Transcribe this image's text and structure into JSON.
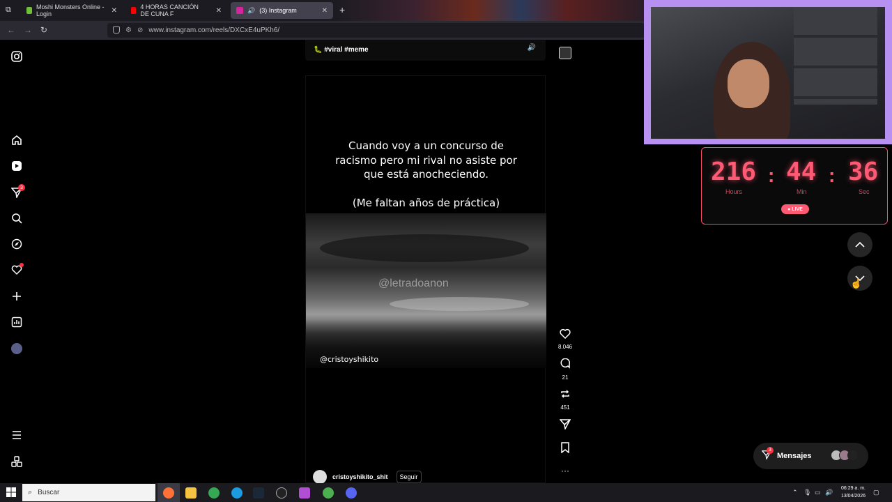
{
  "browser": {
    "tabs": [
      {
        "title": "Moshi Monsters Online - Login",
        "favicon_color": "#6fbf3b"
      },
      {
        "title": "4 HORAS CANCIÓN DE CUNA F",
        "favicon_color": "#ff0000"
      },
      {
        "title": "(3) Instagram",
        "favicon_color": "#d6249f"
      }
    ],
    "url": "www.instagram.com/reels/DXCxE4uPKh6/",
    "new_tab": "+"
  },
  "sidebar": {
    "notifications_badge": "3"
  },
  "prev_reel": {
    "tags": "🐛 #viral #meme"
  },
  "reel": {
    "caption": [
      "Cuando voy a un concurso de",
      "racismo pero mi rival no asiste por",
      "que está anocheciendo.",
      "",
      "(Me faltan años de práctica)"
    ],
    "watermark": "@letradoanon",
    "credit": "@cristoyshikito",
    "author": "cristoyshikito_shit",
    "follow_label": "Seguir"
  },
  "actions": {
    "likes": "8.046",
    "comments": "21",
    "reposts": "451"
  },
  "timer": {
    "hours": "216",
    "minutes": "44",
    "seconds": "36",
    "hours_label": "Hours",
    "min_label": "Min",
    "sec_label": "Sec",
    "live_label": "● LIVE"
  },
  "messages": {
    "label": "Mensajes",
    "badge": "3"
  },
  "taskbar": {
    "search_placeholder": "Buscar",
    "time": "06:29 a. m.",
    "date": "13/04/2026"
  },
  "colors": {
    "accent_timer": "#ff5a74",
    "webcam_border": "#b890f2",
    "badge": "#ff3040"
  }
}
